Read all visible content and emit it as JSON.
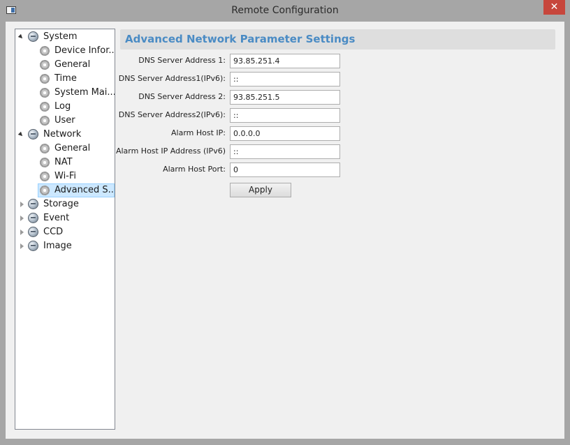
{
  "window": {
    "title": "Remote Configuration",
    "close_glyph": "✕"
  },
  "tree": {
    "groups": [
      {
        "label": "System",
        "expanded": true,
        "icon": "globe-icon",
        "children": [
          "Device Infor...",
          "General",
          "Time",
          "System Mai...",
          "Log",
          "User"
        ]
      },
      {
        "label": "Network",
        "expanded": true,
        "icon": "globe-icon",
        "children": [
          "General",
          "NAT",
          "Wi-Fi",
          "Advanced S..."
        ]
      },
      {
        "label": "Storage",
        "expanded": false,
        "icon": "globe-icon",
        "children": []
      },
      {
        "label": "Event",
        "expanded": false,
        "icon": "globe-icon",
        "children": []
      },
      {
        "label": "CCD",
        "expanded": false,
        "icon": "globe-icon",
        "children": []
      },
      {
        "label": "Image",
        "expanded": false,
        "icon": "globe-icon",
        "children": []
      }
    ],
    "selected": "Advanced S..."
  },
  "panel": {
    "title": "Advanced Network Parameter Settings",
    "fields": [
      {
        "label": "DNS Server Address 1:",
        "value": "93.85.251.4"
      },
      {
        "label": "DNS Server Address1(IPv6):",
        "value": "::"
      },
      {
        "label": "DNS Server Address 2:",
        "value": "93.85.251.5"
      },
      {
        "label": "DNS Server Address2(IPv6):",
        "value": "::"
      },
      {
        "label": "Alarm Host IP:",
        "value": "0.0.0.0"
      },
      {
        "label": "Alarm Host IP Address (IPv6)",
        "value": "::"
      },
      {
        "label": "Alarm Host Port:",
        "value": "0"
      }
    ],
    "apply_label": "Apply"
  },
  "colors": {
    "accent": "#4a8bc4",
    "close": "#c7463c",
    "selection": "#cce8ff"
  }
}
